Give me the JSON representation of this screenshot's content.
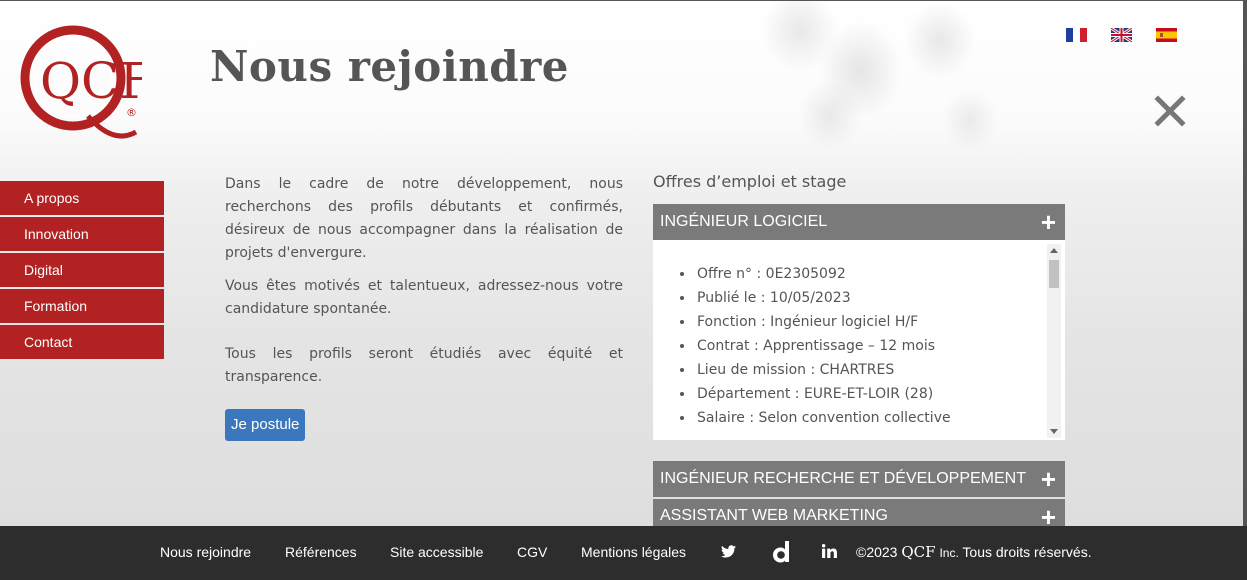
{
  "header": {
    "title": "Nous rejoindre"
  },
  "logo": {
    "text": "QCF",
    "mark": "®"
  },
  "languages": [
    {
      "code": "fr",
      "icon": "flag-fr-icon"
    },
    {
      "code": "en",
      "icon": "flag-uk-icon"
    },
    {
      "code": "es",
      "icon": "flag-es-icon"
    }
  ],
  "sidebar": {
    "items": [
      {
        "label": "A propos"
      },
      {
        "label": "Innovation"
      },
      {
        "label": "Digital"
      },
      {
        "label": "Formation"
      },
      {
        "label": "Contact"
      }
    ]
  },
  "intro": {
    "p1": "Dans le cadre de notre développement, nous recherchons des profils débutants et confirmés, désireux de nous accompagner dans la réalisation de projets d'envergure.",
    "p2": "Vous êtes motivés et talentueux, adressez-nous votre candidature spontanée.",
    "p3": "Tous les profils seront étudiés avec équité et transparence.",
    "apply_label": "Je postule"
  },
  "offers": {
    "title": "Offres d’emploi et stage",
    "jobs": [
      {
        "title": "INGÉNIEUR LOGICIEL",
        "details": [
          "Offre n° : 0E2305092",
          "Publié le : 10/05/2023",
          "Fonction : Ingénieur logiciel H/F",
          "Contrat : Apprentissage – 12 mois",
          "Lieu de mission : CHARTRES",
          "Département : EURE-ET-LOIR (28)",
          "Salaire : Selon convention collective"
        ]
      },
      {
        "title": "INGÉNIEUR RECHERCHE ET DÉVELOPPEMENT"
      },
      {
        "title": "ASSISTANT WEB MARKETING"
      }
    ],
    "expand_symbol": "+"
  },
  "footer": {
    "links": [
      "Nous rejoindre",
      "Références",
      "Site accessible",
      "CGV",
      "Mentions légales"
    ],
    "social": [
      "twitter-icon",
      "dailymotion-icon",
      "linkedin-icon"
    ],
    "copyright_prefix": "©2023",
    "brand": "QCF",
    "inc": "Inc.",
    "rights": "Tous droits réservés."
  },
  "colors": {
    "accent": "#b22222",
    "button": "#3a77bd",
    "accordion": "#7a7a7a",
    "footer": "#2d2d2d"
  }
}
